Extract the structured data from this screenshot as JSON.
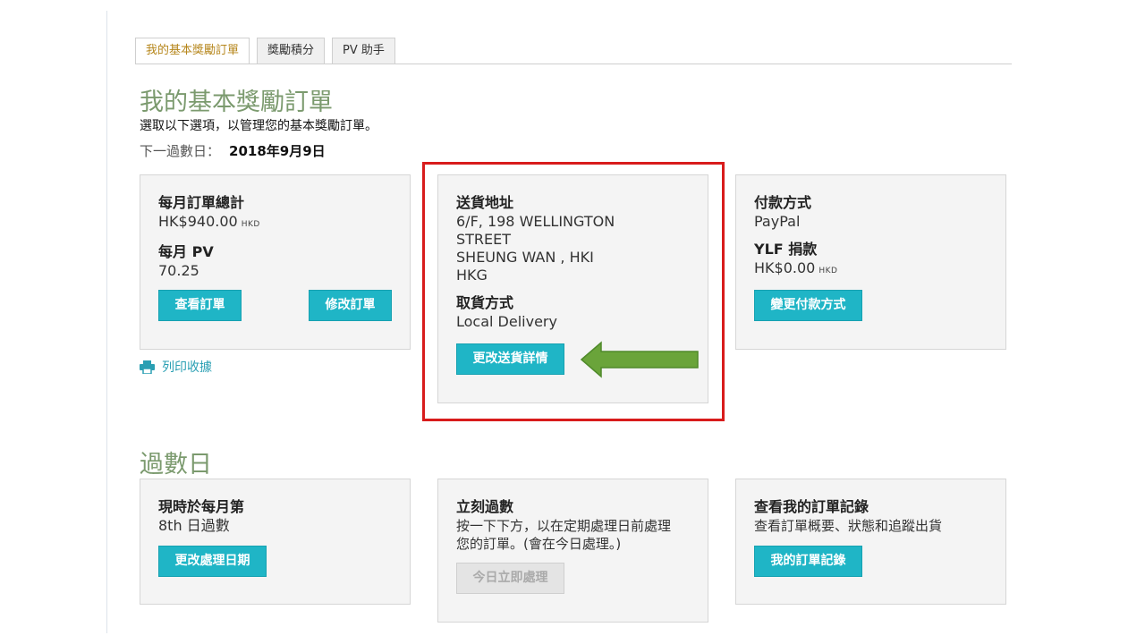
{
  "tabs": [
    {
      "label": "我的基本獎勵訂單",
      "active": true
    },
    {
      "label": "獎勵積分",
      "active": false
    },
    {
      "label": "PV 助手",
      "active": false
    }
  ],
  "page": {
    "title": "我的基本獎勵訂單",
    "subtitle": "選取以下選項，以管理您的基本獎勵訂單。",
    "next_label": "下一過數日：",
    "next_date": "2018年9月9日"
  },
  "monthly_card": {
    "total_heading": "每月訂單總計",
    "total_value": "HK$940.00",
    "total_unit": "HKD",
    "pv_heading": "每月",
    "pv_heading_suffix": "PV",
    "pv_value": "70.25",
    "view_button": "查看訂單",
    "modify_button": "修改訂單"
  },
  "print_link": "列印收據",
  "shipping_card": {
    "address_heading": "送貨地址",
    "address_lines": [
      "6/F, 198 WELLINGTON",
      "STREET",
      "SHEUNG WAN , HKI",
      "HKG"
    ],
    "pickup_heading": "取貨方式",
    "pickup_value": "Local Delivery",
    "change_button": "更改送貨詳情"
  },
  "payment_card": {
    "method_heading": "付款方式",
    "method_value": "PayPal",
    "donation_heading_prefix": "YLF",
    "donation_heading": "捐款",
    "donation_value": "HK$0.00",
    "donation_unit": "HKD",
    "change_button": "變更付款方式"
  },
  "process_section": {
    "title": "過數日",
    "current_card": {
      "heading": "現時於每月第",
      "value_prefix": "8th",
      "value_suffix": "日過數",
      "button": "更改處理日期"
    },
    "now_card": {
      "heading": "立刻過數",
      "description_line1": "按一下下方，以在定期處理日前處理",
      "description_line2": "您的訂單。(會在今日處理。)",
      "button": "今日立即處理"
    },
    "history_card": {
      "heading": "查看我的訂單記錄",
      "description": "查看訂單概要、狀態和追蹤出貨",
      "button": "我的訂單記錄"
    }
  },
  "colors": {
    "accent": "#1fb5c6",
    "title_green": "#7b9a6e",
    "highlight_red": "#d81c1c",
    "arrow_green": "#6aa43a",
    "active_tab": "#b6861b"
  },
  "icons": {
    "print": "printer-icon",
    "arrow": "left-arrow-icon"
  }
}
